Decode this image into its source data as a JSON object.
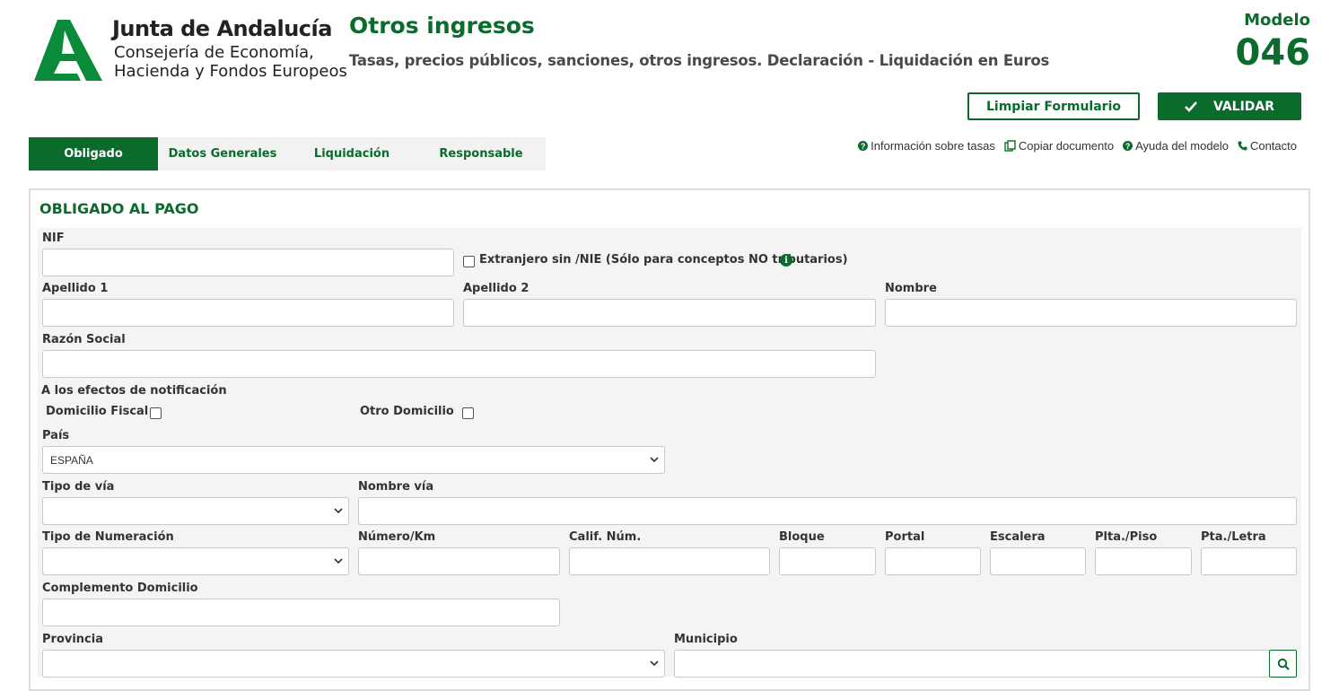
{
  "header": {
    "brand_title": "Junta de Andalucía",
    "brand_line1": "Consejería de Economía,",
    "brand_line2": "Hacienda y Fondos Europeos",
    "page_title": "Otros ingresos",
    "page_subtitle": "Tasas, precios públicos, sanciones, otros ingresos. Declaración - Liquidación en Euros",
    "modelo_label": "Modelo",
    "modelo_number": "046"
  },
  "actions": {
    "clear_label": "Limpiar Formulario",
    "validate_label": "VALIDAR"
  },
  "tabs": [
    {
      "label": "Obligado",
      "active": true
    },
    {
      "label": "Datos Generales",
      "active": false
    },
    {
      "label": "Liquidación",
      "active": false
    },
    {
      "label": "Responsable",
      "active": false
    }
  ],
  "links": {
    "info_tasas": "Información sobre tasas",
    "copiar": "Copiar documento",
    "ayuda": "Ayuda del modelo",
    "contacto": "Contacto"
  },
  "form": {
    "section_title": "OBLIGADO AL PAGO",
    "nif_label": "NIF",
    "nif_value": "",
    "extranjero_label": "Extranjero sin /NIE (Sólo para conceptos NO tributarios)",
    "apellido1_label": "Apellido 1",
    "apellido2_label": "Apellido 2",
    "nombre_label": "Nombre",
    "razon_social_label": "Razón Social",
    "notificacion_label": "A los efectos de notificación",
    "domicilio_fiscal_label": "Domicilio Fiscal",
    "otro_domicilio_label": "Otro Domicilio",
    "pais_label": "País",
    "pais_value": "ESPAÑA",
    "tipo_via_label": "Tipo de vía",
    "nombre_via_label": "Nombre vía",
    "tipo_numeracion_label": "Tipo de Numeración",
    "numero_km_label": "Número/Km",
    "calif_num_label": "Calif. Núm.",
    "bloque_label": "Bloque",
    "portal_label": "Portal",
    "escalera_label": "Escalera",
    "plta_piso_label": "Plta./Piso",
    "pta_letra_label": "Pta./Letra",
    "complemento_label": "Complemento Domicilio",
    "provincia_label": "Provincia",
    "municipio_label": "Municipio"
  },
  "colors": {
    "brand_green": "#0b6b2c"
  }
}
